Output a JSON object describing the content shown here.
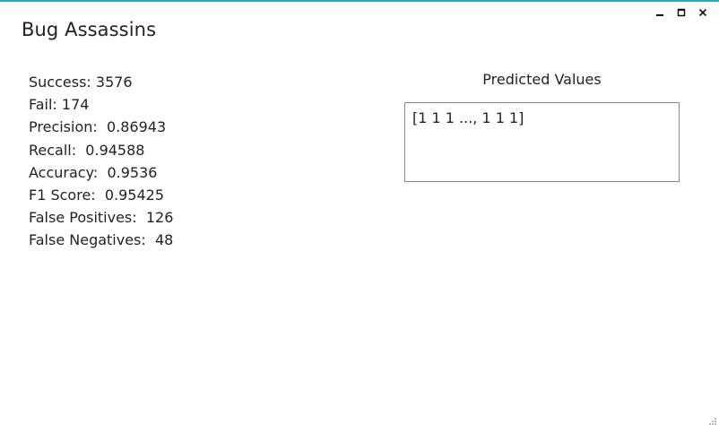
{
  "window": {
    "title": "Bug Assassins",
    "controls": {
      "minimize": "minimize-icon",
      "maximize": "maximize-icon",
      "close": "close-icon"
    },
    "accent_color": "#35a8b8"
  },
  "metrics": [
    {
      "text": "Success: 3576"
    },
    {
      "text": "Fail: 174"
    },
    {
      "text": "Precision:  0.86943"
    },
    {
      "text": "Recall:  0.94588"
    },
    {
      "text": "Accuracy:  0.9536"
    },
    {
      "text": "F1 Score:  0.95425"
    },
    {
      "text": "False Positives:  126"
    },
    {
      "text": "False Negatives:  48"
    }
  ],
  "predicted": {
    "heading": "Predicted Values",
    "value": "[1 1 1 ..., 1 1 1]"
  }
}
